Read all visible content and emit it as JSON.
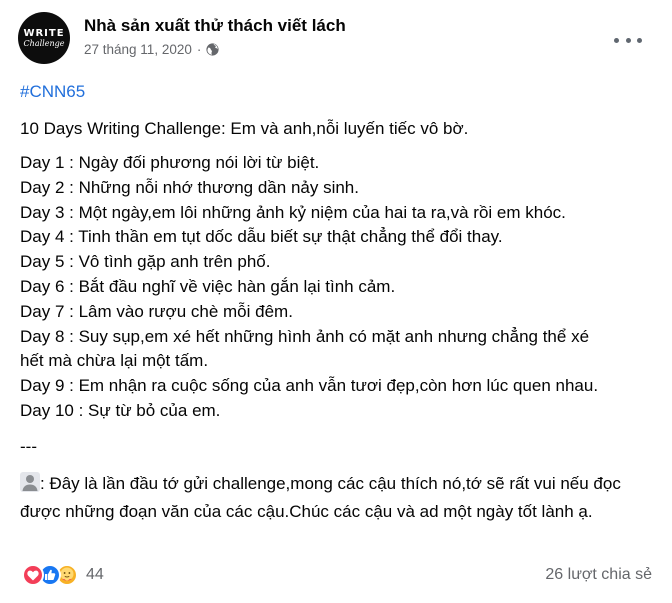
{
  "post": {
    "avatar": {
      "line1": "WRITE",
      "line2": "Challenge"
    },
    "author": "Nhà sản xuất thử thách viết lách",
    "date": "27 tháng 11, 2020",
    "separator": "·",
    "hashtag": "#CNN65",
    "title": "10 Days Writing Challenge: Em và anh,nỗi luyến tiếc vô bờ.",
    "days": [
      "Day 1 : Ngày đối phương nói lời từ biệt.",
      "Day 2 : Những nỗi nhớ thương dần nảy sinh.",
      "Day 3 : Một ngày,em lôi những ảnh kỷ niệm của hai ta ra,và rồi em khóc.",
      "Day 4 : Tinh thần em tụt dốc dẫu biết sự thật chẳng thể đổi thay.",
      "Day 5 : Vô tình gặp anh trên phố.",
      "Day 6 : Bắt đầu nghĩ về việc hàn gắn lại tình cảm.",
      "Day 7 : Lâm vào rượu chè mỗi đêm.",
      "Day 8 : Suy sụp,em xé hết những hình ảnh có mặt anh nhưng chẳng thể xé",
      "hết mà chừa lại một tấm.",
      "Day 9 : Em nhận ra cuộc sống của anh vẫn tươi đẹp,còn hơn lúc quen nhau.",
      "Day 10 : Sự từ bỏ của em."
    ],
    "divider": "---",
    "note": ": Đây là lần đầu tớ gửi challenge,mong các cậu thích nó,tớ sẽ rất vui nếu đọc được những đoạn văn của các cậu.Chúc các cậu và ad một ngày tốt lành ạ."
  },
  "footer": {
    "reactions": [
      "love",
      "like",
      "care"
    ],
    "reaction_count": "44",
    "shares": "26 lượt chia sẻ"
  },
  "colors": {
    "hashtag": "#216fdb",
    "secondary_text": "#65676b",
    "like": "#1877f2",
    "love": "#f33e58",
    "care": "#f7b125"
  }
}
